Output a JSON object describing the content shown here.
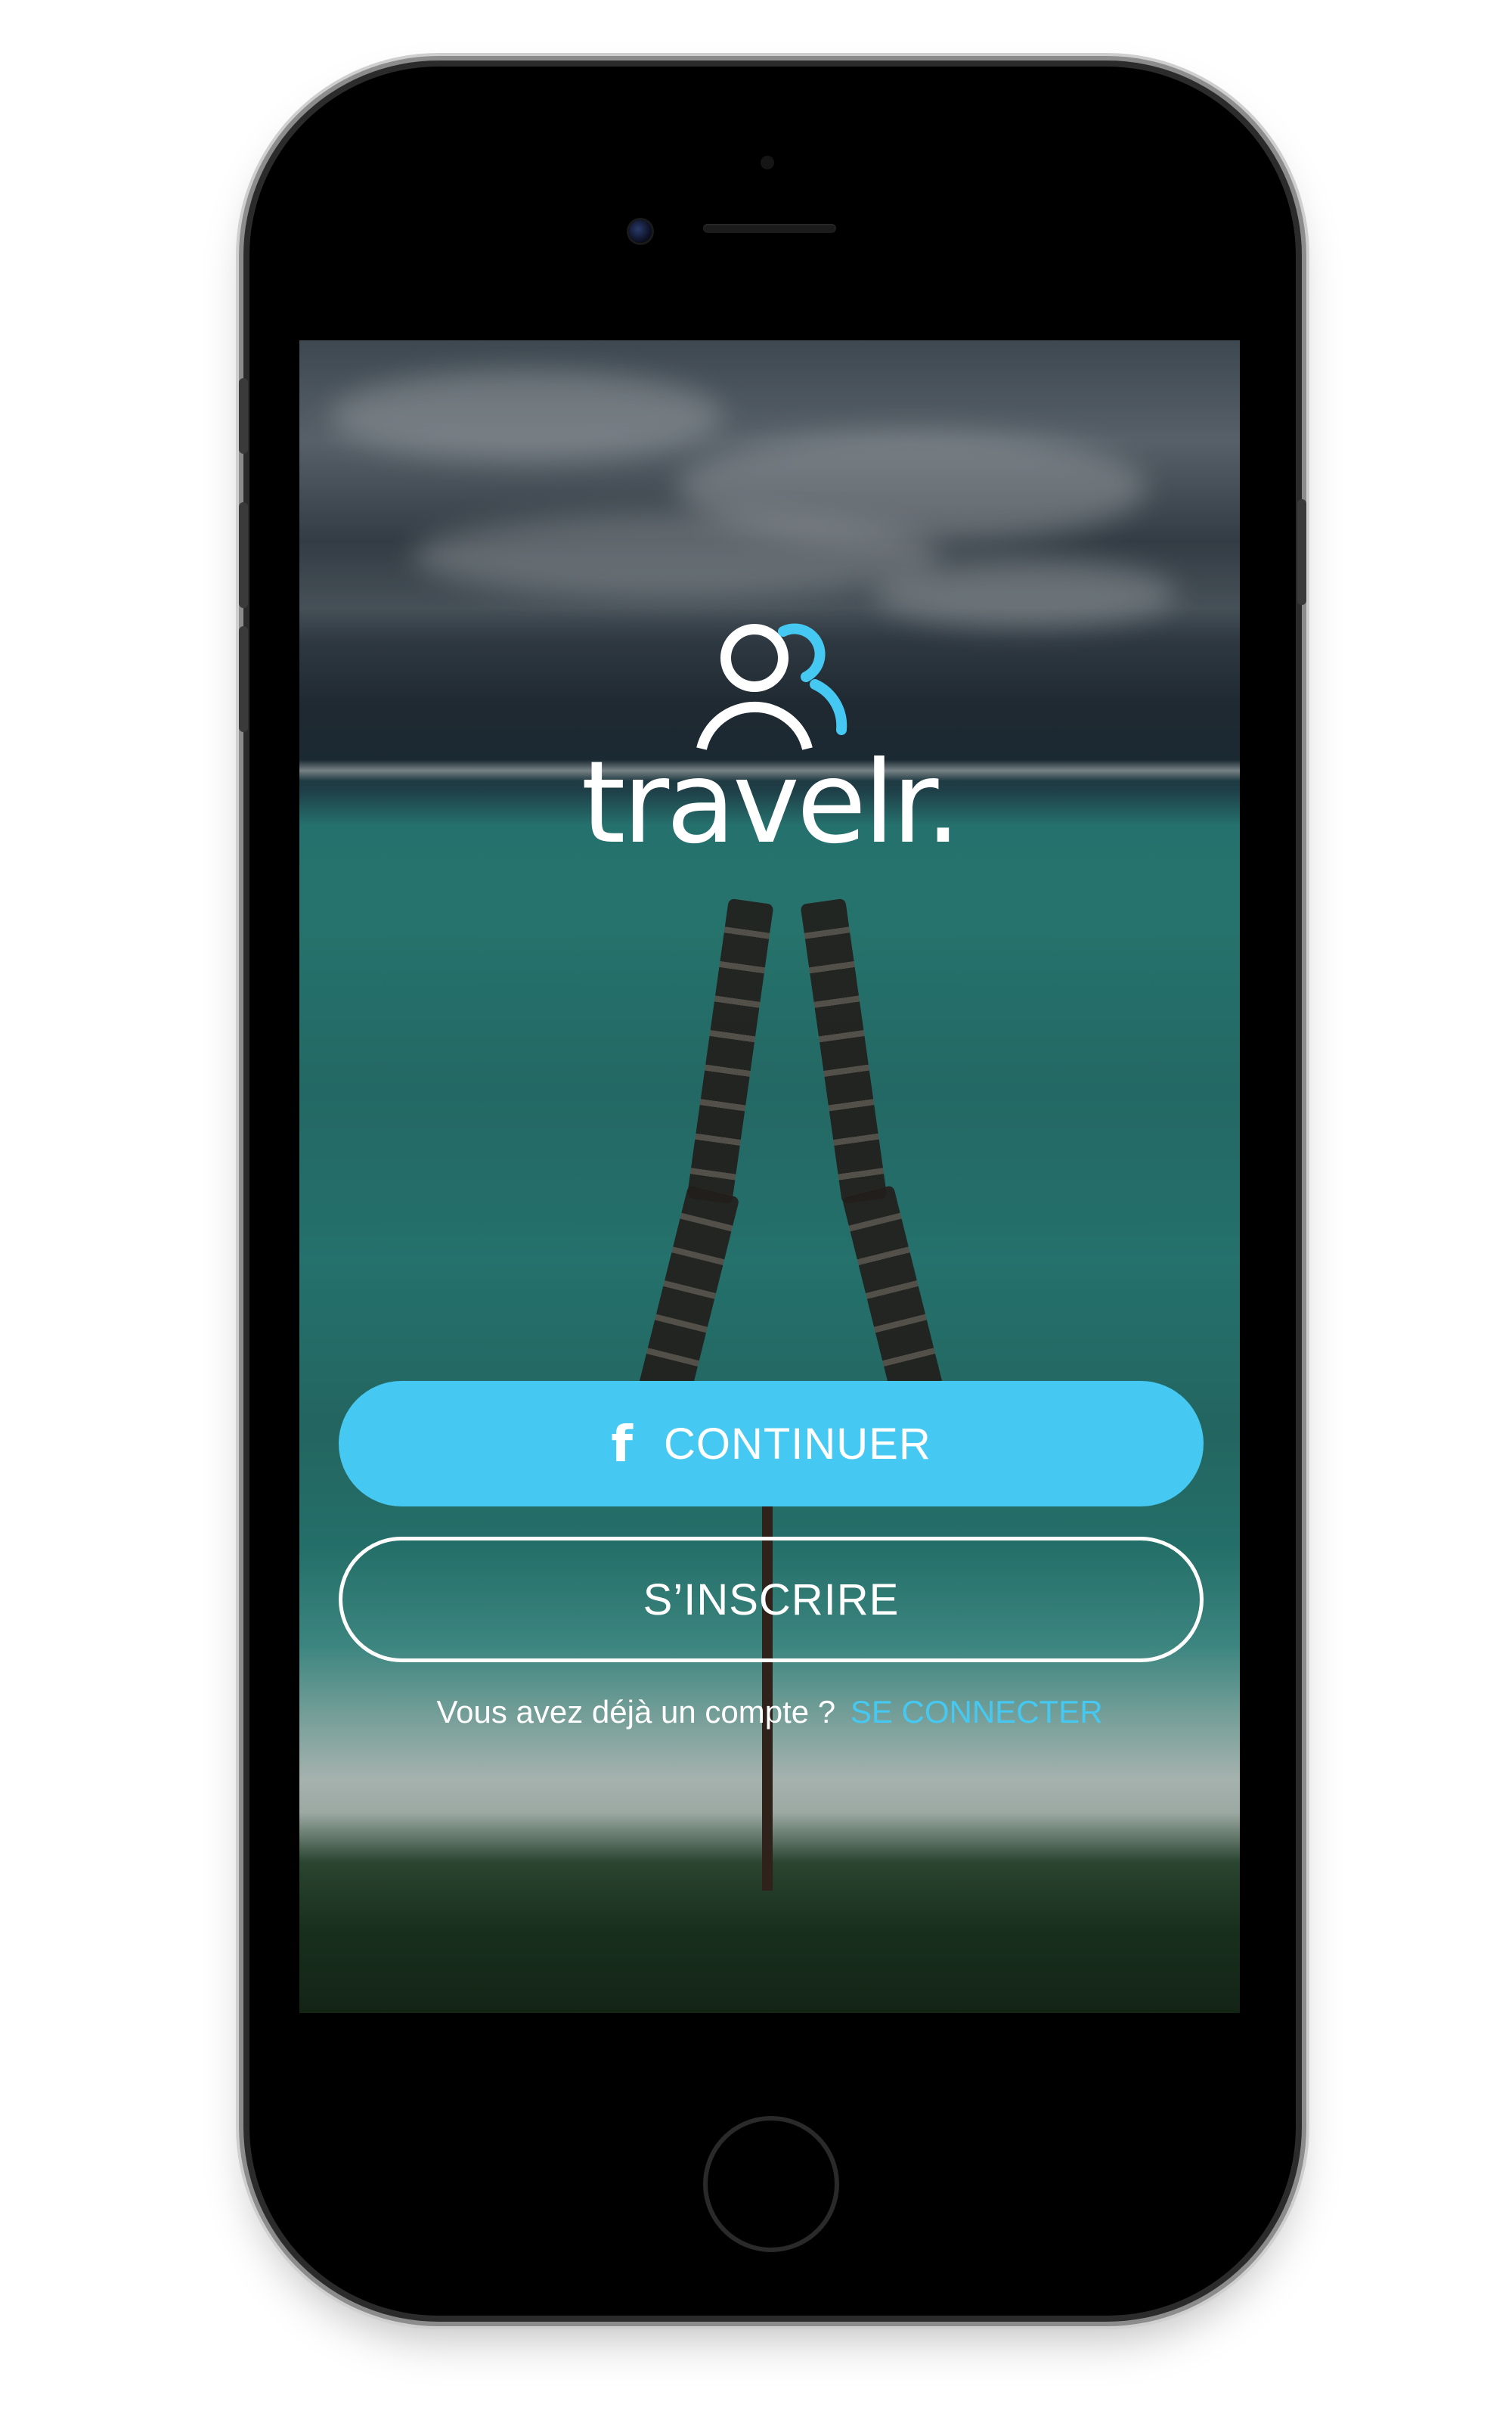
{
  "app": {
    "name": "travelr.",
    "accent_color": "#45c9f2"
  },
  "device": {
    "icons": [
      "front-camera-icon",
      "speaker-grill",
      "home-button"
    ]
  },
  "auth": {
    "facebook_button": {
      "icon": "facebook-icon",
      "label": "CONTINUER"
    },
    "signup_button": {
      "label": "S’INSCRIRE"
    },
    "login_prompt": "Vous avez déjà un compte ?",
    "login_link": "SE CONNECTER"
  }
}
